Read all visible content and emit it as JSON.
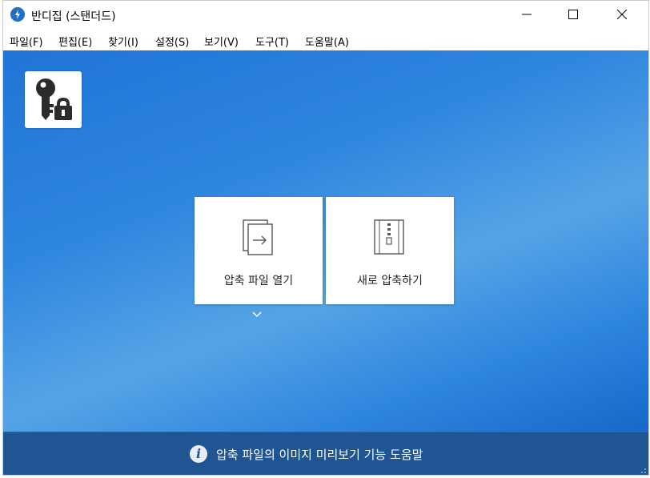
{
  "window": {
    "title": "반디집 (스탠더드)"
  },
  "menu": {
    "items": [
      "파일(F)",
      "편집(E)",
      "찾기(I)",
      "설정(S)",
      "보기(V)",
      "도구(T)",
      "도움말(A)"
    ]
  },
  "main": {
    "open_tile_label": "압축 파일 열기",
    "new_tile_label": "새로 압축하기"
  },
  "footer": {
    "help_text": "압축 파일의 이미지 미리보기 기능 도움말"
  },
  "colors": {
    "accent": "#1f74d6",
    "footer_bg": "#1f5593",
    "app_icon": "#1f6fc8"
  },
  "icons": [
    "bandizip-app-icon",
    "minimize-icon",
    "maximize-icon",
    "close-icon",
    "key-lock-icon",
    "open-archive-icon",
    "zip-archive-icon",
    "chevron-down-icon",
    "info-icon"
  ]
}
